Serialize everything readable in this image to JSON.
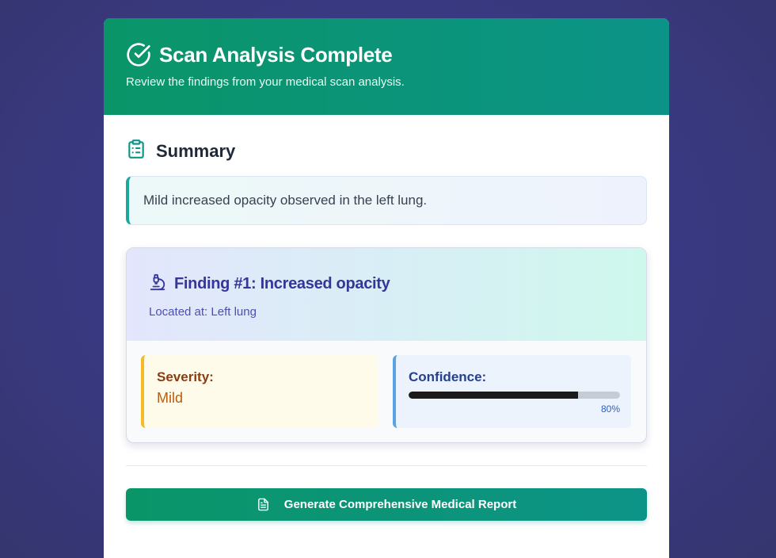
{
  "header": {
    "title": "Scan Analysis Complete",
    "subtitle": "Review the findings from your medical scan analysis.",
    "icon": "check-circle-icon"
  },
  "summary": {
    "heading": "Summary",
    "icon": "clipboard-icon",
    "text": "Mild increased opacity observed in the left lung."
  },
  "findings": [
    {
      "title": "Finding #1: Increased opacity",
      "location": "Located at: Left lung",
      "icon": "microscope-icon",
      "severity_label": "Severity:",
      "severity_value": "Mild",
      "confidence_label": "Confidence:",
      "confidence_value": 0.8,
      "confidence_text": "80%"
    }
  ],
  "actions": {
    "generate_report_label": "Generate Comprehensive Medical Report",
    "generate_report_icon": "document-icon"
  },
  "colors": {
    "accent": "#0a9568",
    "severity_accent": "#f5bb24",
    "confidence_accent": "#5aa2e3"
  }
}
